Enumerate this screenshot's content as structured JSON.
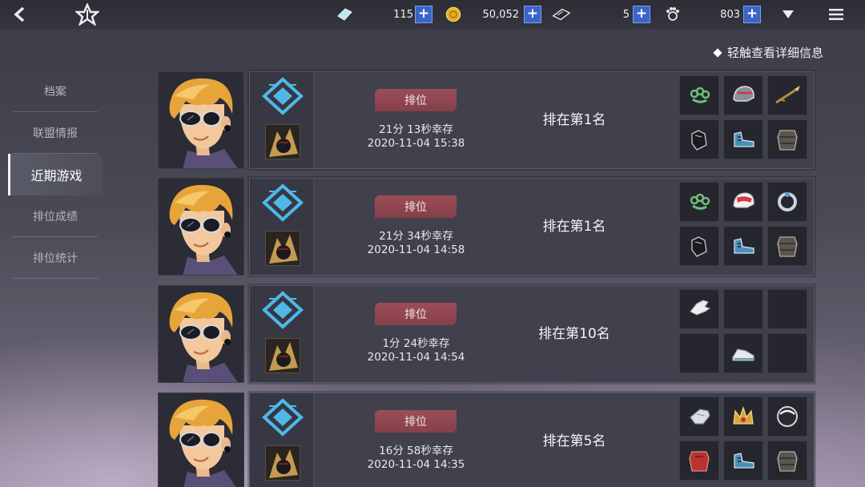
{
  "topbar": {
    "back_icon": "back-arrow-icon",
    "home_icon": "star-emblem-icon",
    "currencies": [
      {
        "icon": "crystal-icon",
        "value": "115"
      },
      {
        "icon": "gold-coin-icon",
        "value": "50,052"
      },
      {
        "icon": "ticket-icon",
        "value": "5"
      },
      {
        "icon": "paw-token-icon",
        "value": "803"
      }
    ],
    "plus_label": "+",
    "dropdown_icon": "triangle-down-icon",
    "menu_icon": "hamburger-menu-icon"
  },
  "hint": {
    "text": "轻触查看详细信息"
  },
  "sidebar": {
    "items": [
      {
        "label": "档案",
        "active": false
      },
      {
        "label": "联盟情报",
        "active": false
      },
      {
        "label": "近期游戏",
        "active": true
      },
      {
        "label": "排位成绩",
        "active": false
      },
      {
        "label": "排位统计",
        "active": false
      }
    ]
  },
  "games": [
    {
      "mode": "排位",
      "survive": "21分 13秒幸存",
      "date": "2020-11-04 15:38",
      "placement": "排在第1名",
      "items": [
        "brass-knuckles",
        "helmet",
        "spear",
        "glove",
        "boots",
        "armor"
      ]
    },
    {
      "mode": "排位",
      "survive": "21分 34秒幸存",
      "date": "2020-11-04 14:58",
      "placement": "排在第1名",
      "items": [
        "brass-knuckles",
        "racing-helmet",
        "bracelet",
        "glove",
        "boots",
        "armor"
      ]
    },
    {
      "mode": "排位",
      "survive": "1分 24秒幸存",
      "date": "2020-11-04 14:54",
      "placement": "排在第10名",
      "items": [
        "white-glove",
        "",
        "",
        "",
        "sneakers",
        ""
      ]
    },
    {
      "mode": "排位",
      "survive": "16分 58秒幸存",
      "date": "2020-11-04 14:35",
      "placement": "排在第5名",
      "items": [
        "gauntlet",
        "crown",
        "disc",
        "red-armor",
        "boots",
        "armor"
      ]
    }
  ],
  "colors": {
    "accent_blue": "#3a64c9",
    "rank_icon": "#4fb8e8",
    "badge_red": "#9c4d57"
  }
}
